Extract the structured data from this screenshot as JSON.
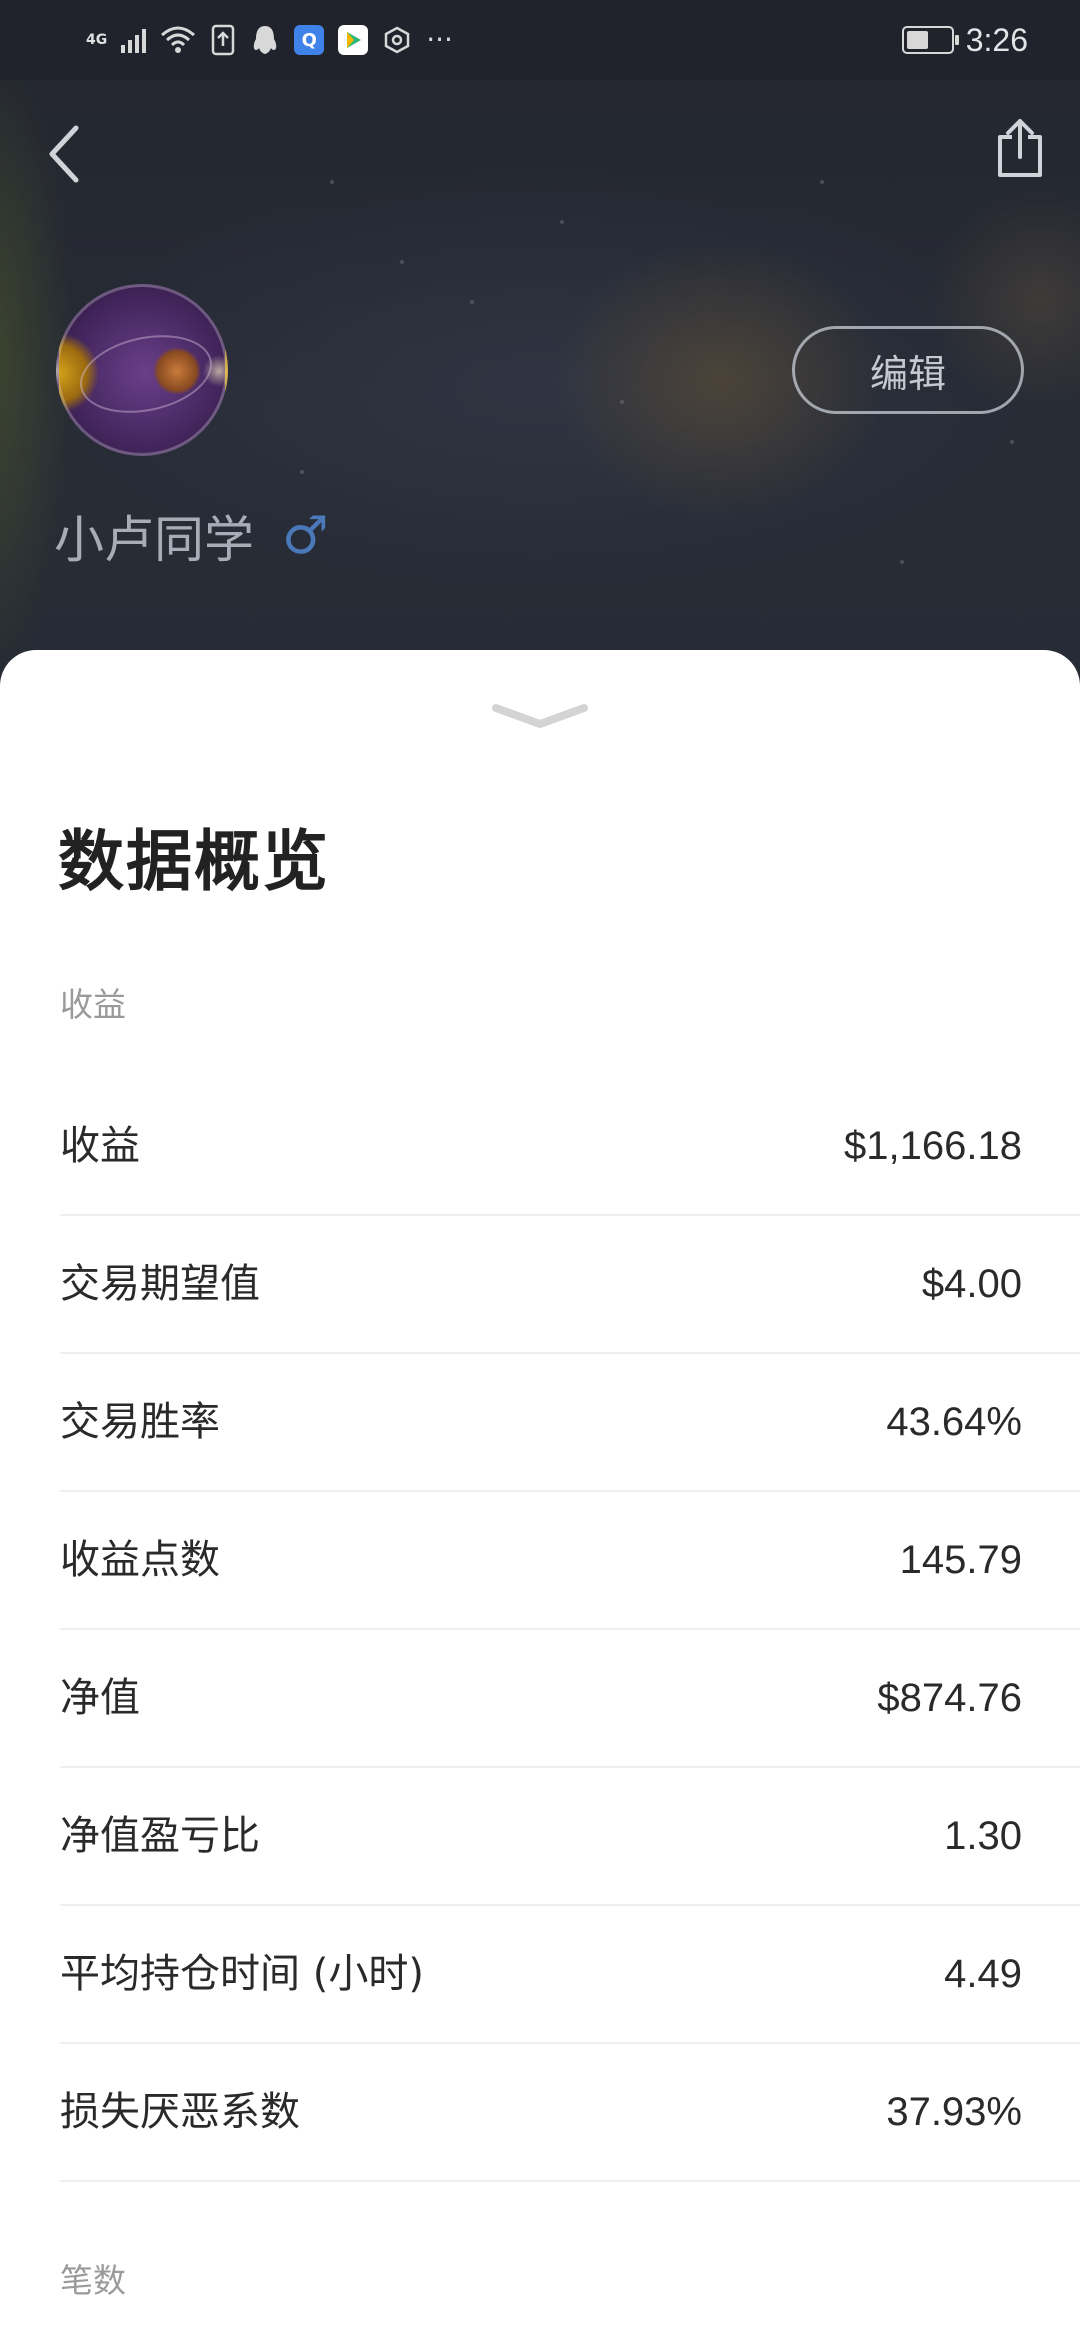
{
  "status_bar": {
    "network": "4G",
    "time": "3:26",
    "more": "···",
    "battery_level": 0.45
  },
  "profile": {
    "username": "小卢同学",
    "gender_symbol": "♂",
    "edit_label": "编辑"
  },
  "sheet": {
    "title": "数据概览",
    "sections": [
      {
        "label": "收益",
        "rows": [
          {
            "label": "收益",
            "value": "$1,166.18"
          },
          {
            "label": "交易期望值",
            "value": "$4.00"
          },
          {
            "label": "交易胜率",
            "value": "43.64%"
          },
          {
            "label": "收益点数",
            "value": "145.79"
          },
          {
            "label": "净值",
            "value": "$874.76"
          },
          {
            "label": "净值盈亏比",
            "value": "1.30"
          },
          {
            "label": "平均持仓时间 (小时)",
            "value": "4.49"
          },
          {
            "label": "损失厌恶系数",
            "value": "37.93%"
          }
        ]
      },
      {
        "label": "笔数",
        "rows": []
      }
    ]
  },
  "icons": {
    "back": "chevron-left-icon",
    "share": "share-icon",
    "collapse": "chevron-down-icon"
  },
  "colors": {
    "gender_male": "#4a78b8",
    "sheet_bg": "#ffffff",
    "divider": "#eeeeee"
  }
}
